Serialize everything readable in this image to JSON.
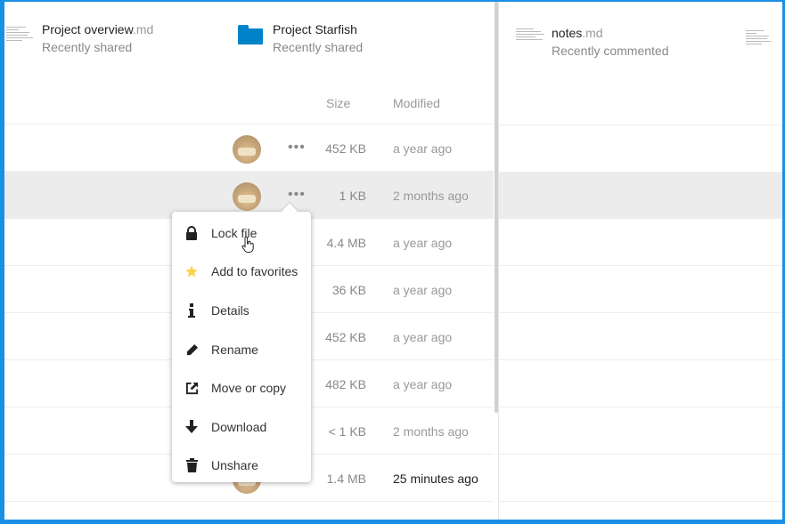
{
  "recent": [
    {
      "name": "Project overview",
      "ext": ".md",
      "subtitle": "Recently shared",
      "icon": "document-thumbnail-icon"
    },
    {
      "name": "Project Starfish",
      "ext": "",
      "subtitle": "Recently shared",
      "icon": "folder-icon"
    },
    {
      "name": "notes",
      "ext": ".md",
      "subtitle": "Recently commented",
      "icon": "document-thumbnail-icon"
    }
  ],
  "table": {
    "columns": {
      "size": "Size",
      "modified": "Modified"
    },
    "rows": [
      {
        "size": "452 KB",
        "modified": "a year ago"
      },
      {
        "size": "1 KB",
        "modified": "2 months ago"
      },
      {
        "size": "4.4 MB",
        "modified": "a year ago"
      },
      {
        "size": "36 KB",
        "modified": "a year ago"
      },
      {
        "size": "452 KB",
        "modified": "a year ago"
      },
      {
        "size": "482 KB",
        "modified": "a year ago"
      },
      {
        "size": "< 1 KB",
        "modified": "2 months ago"
      },
      {
        "size": "1.4 MB",
        "modified": "25 minutes ago"
      }
    ],
    "more_icon": "•••"
  },
  "menu": [
    {
      "label": "Lock file",
      "icon": "lock-icon"
    },
    {
      "label": "Add to favorites",
      "icon": "star-icon"
    },
    {
      "label": "Details",
      "icon": "info-icon"
    },
    {
      "label": "Rename",
      "icon": "pencil-icon"
    },
    {
      "label": "Move or copy",
      "icon": "external-link-icon"
    },
    {
      "label": "Download",
      "icon": "download-icon"
    },
    {
      "label": "Unshare",
      "icon": "trash-icon"
    }
  ],
  "colors": {
    "accent": "#0082c9",
    "frame": "#1a8fe6",
    "selected_row": "#ececec",
    "star": "#fbd24d"
  }
}
